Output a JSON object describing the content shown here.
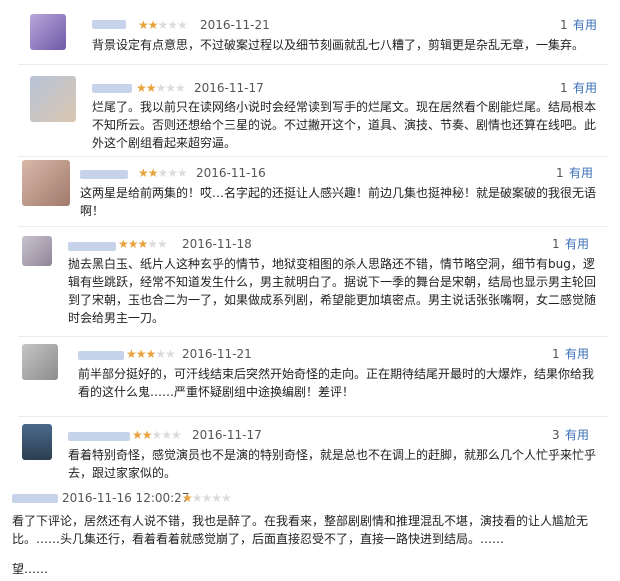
{
  "reviews": [
    {
      "date": "2016-11-21",
      "rating": 2,
      "useful_count": "1",
      "useful_label": "有用",
      "text": "背景设定有点意思，不过破案过程以及细节刻画就乱七八糟了，剪辑更是杂乱无章，一集弃。"
    },
    {
      "date": "2016-11-17",
      "rating": 2,
      "useful_count": "1",
      "useful_label": "有用",
      "text": "烂尾了。我以前只在读网络小说时会经常读到写手的烂尾文。现在居然看个剧能烂尾。结局根本不知所云。否则还想给个三星的说。不过撇开这个，道具、演技、节奏、剧情也还算在线吧。此外这个剧组看起来超穷逼。"
    },
    {
      "date": "2016-11-16",
      "rating": 2,
      "useful_count": "1",
      "useful_label": "有用",
      "text": "这两星是给前两集的！哎…名字起的还挺让人感兴趣！前边几集也挺神秘！就是破案破的我很无语啊！"
    },
    {
      "date": "2016-11-18",
      "rating": 3,
      "useful_count": "1",
      "useful_label": "有用",
      "text": "抛去黑白玉、纸片人这种玄乎的情节，地狱变相图的杀人思路还不错，情节略空洞，细节有bug，逻辑有些跳跃，经常不知道发生什么，男主就明白了。据说下一季的舞台是宋朝，结局也显示男主轮回到了宋朝，玉也合二为一了，如果做成系列剧，希望能更加填密点。男主说话张张嘴啊，女二感觉随时会给男主一刀。"
    },
    {
      "date": "2016-11-21",
      "rating": 3,
      "useful_count": "1",
      "useful_label": "有用",
      "text": "前半部分挺好的，可汗线结束后突然开始奇怪的走向。正在期待结尾开最时的大爆炸，结果你给我看的这什么鬼……严重怀疑剧组中途换编剧！差评！"
    },
    {
      "date": "2016-11-17",
      "rating": 2,
      "useful_count": "3",
      "useful_label": "有用",
      "text": "看着特别奇怪，感觉演员也不是演的特别奇怪，就是总也不在调上的赶脚，就那么几个人忙乎来忙乎去，跟过家家似的。"
    },
    {
      "date": "2016-11-16 12:00:27",
      "rating": 1,
      "text": "看了下评论，居然还有人说不错，我也是醉了。在我看来，整部剧剧情和推理混乱不堪，演技看的让人尴尬无比。……头几集还行，看着看着就感觉崩了，后面直接忍受不了，直接一路快进到结局。……"
    }
  ],
  "last_text_tail": "望……"
}
